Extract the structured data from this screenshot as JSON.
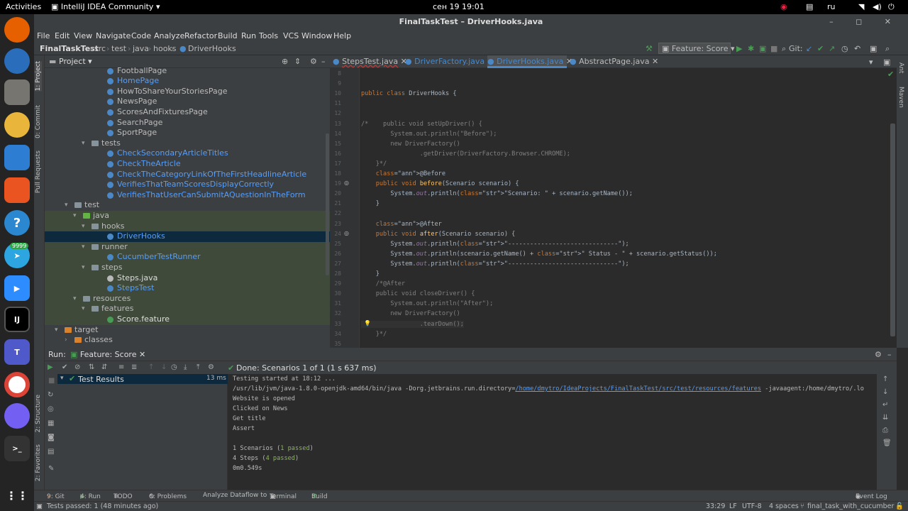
{
  "topbar": {
    "activities": "Activities",
    "app_name": "IntelliJ IDEA Community",
    "clock": "сен 19  19:01",
    "lang": "ru"
  },
  "dock": {
    "badge": "9999",
    "ij": "IJ",
    "terminal": ">_"
  },
  "window": {
    "title": "FinalTaskTest – DriverHooks.java",
    "controls": "– ◻ ✕"
  },
  "menu": [
    "File",
    "Edit",
    "View",
    "Navigate",
    "Code",
    "Analyze",
    "Refactor",
    "Build",
    "Run",
    "Tools",
    "VCS",
    "Window",
    "Help"
  ],
  "navbar": {
    "crumbs": [
      "FinalTaskTest",
      "src",
      "test",
      "java",
      "hooks",
      "DriverHooks"
    ],
    "run_config": "Feature: Score",
    "git_label": "Git:"
  },
  "left_tools": [
    "1: Project",
    "0: Commit",
    "Pull Requests",
    "2: Structure",
    "2: Favorites"
  ],
  "right_tools": [
    "Ant",
    "Maven"
  ],
  "project": {
    "header": "Project",
    "tree": [
      {
        "label": "FootballPage",
        "kind": "class"
      },
      {
        "label": "HomePage",
        "kind": "class-blue"
      },
      {
        "label": "HowToShareYourStoriesPage",
        "kind": "class"
      },
      {
        "label": "NewsPage",
        "kind": "class"
      },
      {
        "label": "ScoresAndFixturesPage",
        "kind": "class"
      },
      {
        "label": "SearchPage",
        "kind": "class"
      },
      {
        "label": "SportPage",
        "kind": "class"
      },
      {
        "label": "tests",
        "kind": "folder"
      },
      {
        "label": "CheckSecondaryArticleTitles",
        "kind": "class-blue"
      },
      {
        "label": "CheckTheArticle",
        "kind": "class-blue"
      },
      {
        "label": "CheckTheCategoryLinkOfTheFirstHeadlineArticle",
        "kind": "class-blue"
      },
      {
        "label": "VerifiesThatTeamScoresDisplayCorrectly",
        "kind": "class-blue"
      },
      {
        "label": "VerifiesThatUserCanSubmitAQuestionInTheForm",
        "kind": "class-blue"
      },
      {
        "label": "test",
        "kind": "folder"
      },
      {
        "label": "java",
        "kind": "folder-green"
      },
      {
        "label": "hooks",
        "kind": "folder"
      },
      {
        "label": "DriverHooks",
        "kind": "class-blue"
      },
      {
        "label": "runner",
        "kind": "folder"
      },
      {
        "label": "CucumberTestRunner",
        "kind": "class-blue"
      },
      {
        "label": "steps",
        "kind": "folder"
      },
      {
        "label": "Steps.java",
        "kind": "java"
      },
      {
        "label": "StepsTest",
        "kind": "class-blue"
      },
      {
        "label": "resources",
        "kind": "folder"
      },
      {
        "label": "features",
        "kind": "folder"
      },
      {
        "label": "Score.feature",
        "kind": "feature"
      },
      {
        "label": "target",
        "kind": "folder-orange"
      },
      {
        "label": "classes",
        "kind": "folder-orange"
      }
    ]
  },
  "tabs": [
    "StepsTest.java",
    "DriverFactory.java",
    "DriverHooks.java",
    "AbstractPage.java"
  ],
  "code": {
    "line_numbers": [
      "8",
      "9",
      "10",
      "11",
      "12",
      "13",
      "14",
      "15",
      "16",
      "17",
      "18",
      "19",
      "20",
      "21",
      "22",
      "23",
      "24",
      "25",
      "26",
      "27",
      "28",
      "29",
      "30",
      "31",
      "32",
      "33",
      "34",
      "35"
    ],
    "lines": [
      "",
      "",
      "public class DriverHooks {",
      "",
      "",
      "/*    public void setUpDriver() {",
      "        System.out.println(\"Before\");",
      "        new DriverFactory()",
      "                .getDriver(DriverFactory.Browser.CHROME);",
      "    }*/",
      "    @Before",
      "    public void before(Scenario scenario) {",
      "        System.out.println(\"Scenario: \" + scenario.getName());",
      "    }",
      "",
      "    @After",
      "    public void after(Scenario scenario) {",
      "        System.out.println(\"------------------------------\");",
      "        System.out.println(scenario.getName() + \" Status - \" + scenario.getStatus());",
      "        System.out.println(\"------------------------------\");",
      "    }",
      "    /*@After",
      "    public void closeDriver() {",
      "        System.out.println(\"After\");",
      "        new DriverFactory()",
      "                .tearDown();",
      "    }*/",
      ""
    ]
  },
  "run": {
    "label": "Run:",
    "config_tab": "Feature: Score",
    "status": "Done: Scenarios 1 of 1 (1 s 637 ms)",
    "test_results": "Test Results",
    "test_time": "13 ms",
    "console": [
      "Testing started at 18:12 ...",
      "/usr/lib/jvm/java-1.8.0-openjdk-amd64/bin/java -Dorg.jetbrains.run.directory=/home/dmytro/IdeaProjects/FinalTaskTest/src/test/resources/features -javaagent:/home/dmytro/.lo",
      "Website is opened",
      "Clicked on News",
      "Get title",
      "Assert",
      "",
      "1 Scenarios (1 passed)",
      "4 Steps (4 passed)",
      "0m0.549s"
    ]
  },
  "bottom_tabs": [
    "9: Git",
    "4: Run",
    "TODO",
    "6: Problems",
    "Analyze Dataflow to",
    "Terminal",
    "Build",
    "Event Log"
  ],
  "status": {
    "message": "Tests passed: 1 (48 minutes ago)",
    "position": "33:29",
    "line_sep": "LF",
    "encoding": "UTF-8",
    "indent": "4 spaces",
    "branch": "final_task_with_cucumber"
  },
  "colors": {
    "accent": "#4a88c7",
    "selection": "#0d293e",
    "green": "#499c54"
  }
}
